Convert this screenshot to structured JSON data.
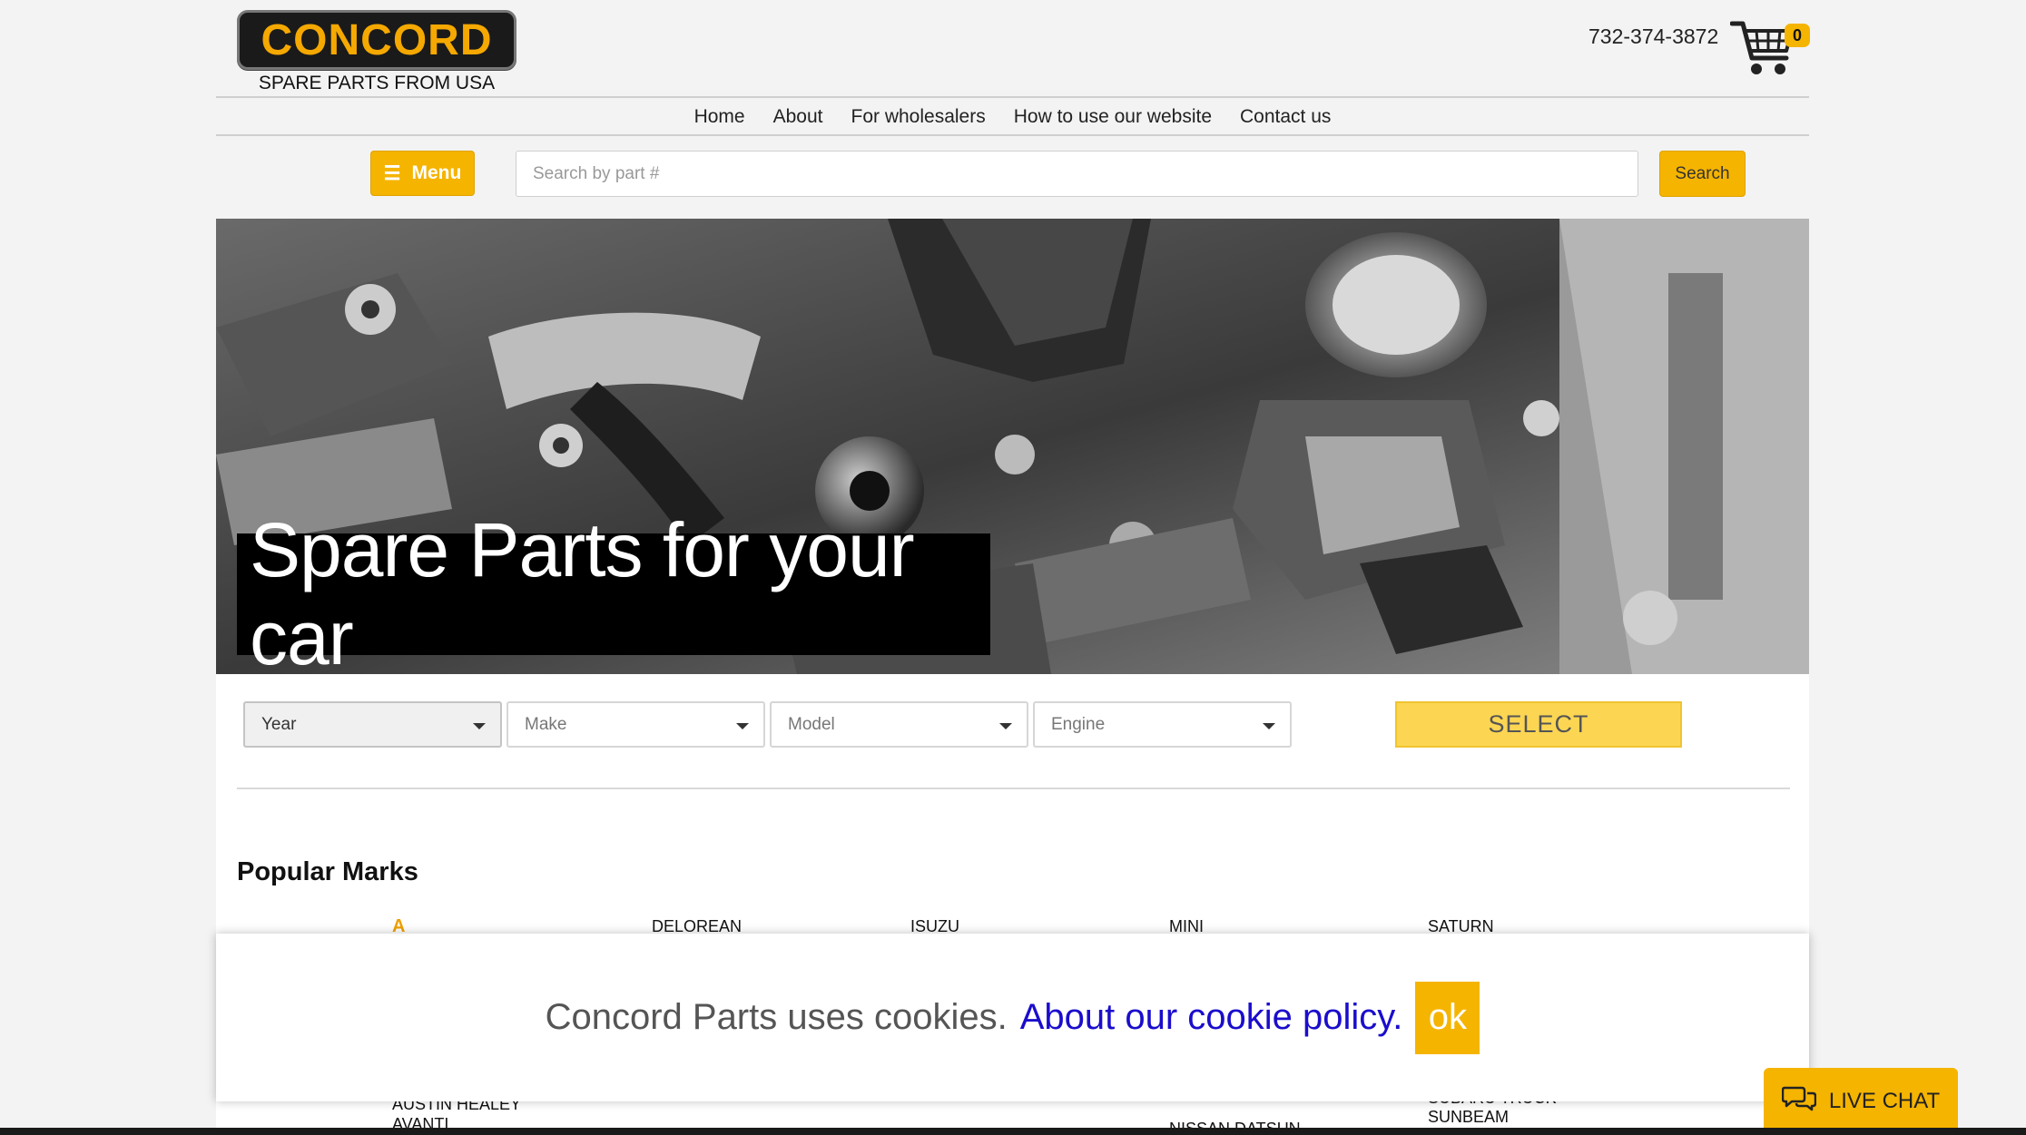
{
  "header": {
    "logo_text": "CONCORD",
    "tagline": "SPARE PARTS FROM USA",
    "phone": "732-374-3872",
    "cart_count": "0"
  },
  "nav": {
    "items": [
      {
        "label": "Home"
      },
      {
        "label": "About"
      },
      {
        "label": "For wholesalers"
      },
      {
        "label": "How to use our website"
      },
      {
        "label": "Contact us"
      }
    ]
  },
  "search": {
    "menu_label": "Menu",
    "placeholder": "Search by part #",
    "button_label": "Search"
  },
  "hero": {
    "title": "Spare Parts for your car"
  },
  "vehicle_selector": {
    "year": "Year",
    "make": "Make",
    "model": "Model",
    "engine": "Engine",
    "select_label": "SELECT"
  },
  "popular": {
    "heading": "Popular Marks",
    "letter": "A",
    "marks_top": [
      "DELOREAN",
      "ISUZU",
      "MINI",
      "SATURN"
    ],
    "marks_bottom": [
      "AUSTIN HEALEY",
      "AVANTI",
      "NISSAN DATSUN",
      "SUBARU TRUCK",
      "SUNBEAM"
    ]
  },
  "cookie": {
    "text": "Concord Parts uses cookies.",
    "link": "About our cookie policy.",
    "ok": "ok"
  },
  "chat": {
    "label": "LIVE CHAT"
  },
  "colors": {
    "accent": "#f5b400",
    "link": "#1a0dcc"
  }
}
